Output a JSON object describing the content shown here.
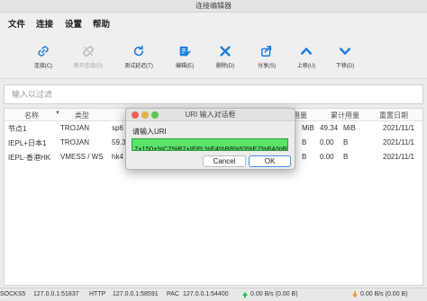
{
  "window": {
    "title": "连接编辑器"
  },
  "menu": {
    "file": "文件",
    "connect": "连接",
    "settings": "设置",
    "help": "帮助"
  },
  "toolbar": {
    "connect": "连接(C)",
    "disconnect": "断开连接(D)",
    "latency": "测试延迟(T)",
    "edit": "编辑(E)",
    "delete": "删除(D)",
    "share": "分享(S)",
    "move_up": "上移(U)",
    "move_down": "下移(D)"
  },
  "filter": {
    "placeholder": "输入以过滤"
  },
  "table": {
    "headers": {
      "name": "名称",
      "type": "类型",
      "traffic": "用量",
      "total": "累计用量",
      "reset": "重置日期"
    },
    "rows": [
      {
        "name": "节点1",
        "type": "TROJAN",
        "addr": "sp6",
        "traffic": "MiB",
        "total_num": "49.34",
        "total_unit": "MiB",
        "reset": "2021/11/1"
      },
      {
        "name": "IEPL+日本1",
        "type": "TROJAN",
        "addr": "59.3",
        "traffic": "B",
        "total_num": "0.00",
        "total_unit": "B",
        "reset": "2021/11/1"
      },
      {
        "name": "IEPL·香港HK",
        "type": "VMESS / WS",
        "addr": "hk4",
        "traffic": "B",
        "total_num": "0.00",
        "total_unit": "B",
        "reset": "2021/11/1"
      }
    ]
  },
  "dialog": {
    "title": "URI 输入对话框",
    "prompt": "请输入URI",
    "value": "7+150+%C2%B7+IEPL%E4%B8%93%E7%BA%BF",
    "cancel": "Cancel",
    "ok": "OK"
  },
  "status": {
    "socks": "SOCKS5",
    "socks_addr": "127.0.0.1:51837",
    "http": "HTTP",
    "http_addr": "127.0.0.1:58591",
    "pac": "PAC",
    "pac_addr": "127.0.0.1:54400",
    "up_speed": "0.00 B/s (0.00 B)",
    "down_speed": "0.00 B/s (0.00 B)"
  },
  "colors": {
    "icon_blue": "#1d7fe0",
    "icon_disabled": "#b9b9b9",
    "dialog_input_bg": "#5ce36a",
    "traffic_light_red": "#ec5f57",
    "traffic_light_yellow": "#dfb245",
    "traffic_light_green": "#5fc456",
    "status_green": "#2db94d",
    "status_orange": "#f0962a"
  }
}
